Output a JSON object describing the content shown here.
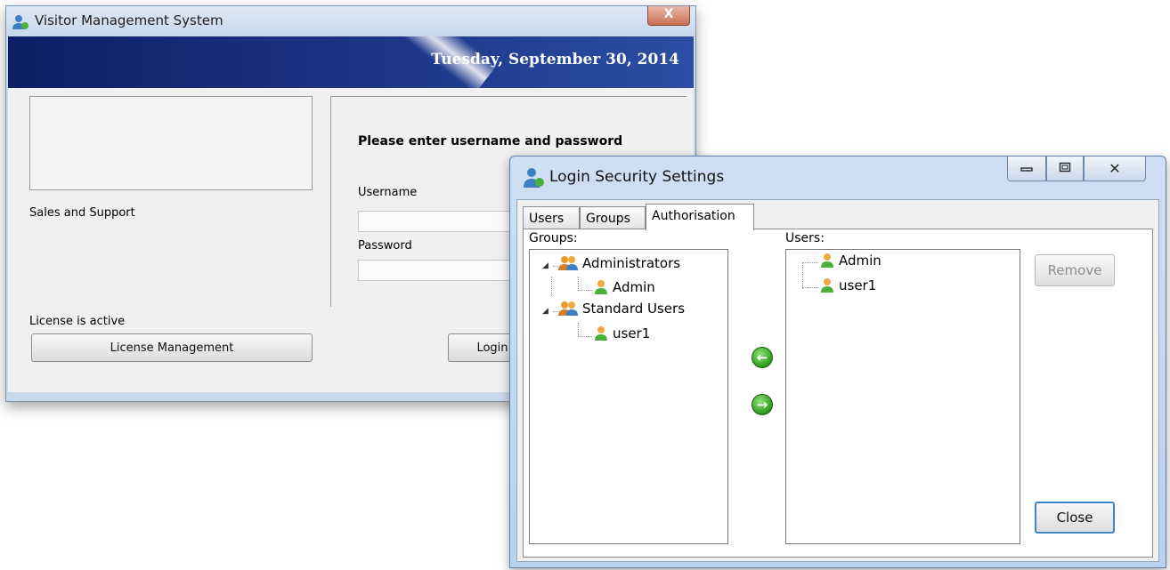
{
  "main_window": {
    "title": "Visitor Management System",
    "close_label": "X",
    "date": "Tuesday, September 30, 2014",
    "sales_support": "Sales and Support",
    "license_status": "License is active",
    "license_button": "License Management",
    "login_prompt": "Please enter username and password",
    "username_label": "Username",
    "username_value": "",
    "password_label": "Password",
    "password_value": "",
    "login_button": "Login",
    "colors": {
      "banner": "#1c3687",
      "chrome": "#c9d9ec"
    }
  },
  "dialog": {
    "title": "Login Security Settings",
    "close_label": "✕",
    "icons": {
      "app": "user-app-icon",
      "minimize": "minimize-icon",
      "maximize": "maximize-icon",
      "close": "close-icon"
    },
    "tabs": [
      {
        "label": "Users",
        "active": false
      },
      {
        "label": "Groups",
        "active": false
      },
      {
        "label": "Authorisation",
        "active": true
      }
    ],
    "groups_label": "Groups:",
    "users_label": "Users:",
    "groups_tree": [
      {
        "label": "Administrators",
        "icon": "group-icon",
        "children": [
          {
            "label": "Admin",
            "icon": "user-icon"
          }
        ]
      },
      {
        "label": "Standard Users",
        "icon": "group-icon",
        "children": [
          {
            "label": "user1",
            "icon": "user-icon"
          }
        ]
      }
    ],
    "users_list": [
      {
        "label": "Admin",
        "icon": "user-icon"
      },
      {
        "label": "user1",
        "icon": "user-icon"
      }
    ],
    "add_arrow": "←",
    "remove_arrow": "→",
    "remove_button": "Remove",
    "close_button": "Close"
  }
}
